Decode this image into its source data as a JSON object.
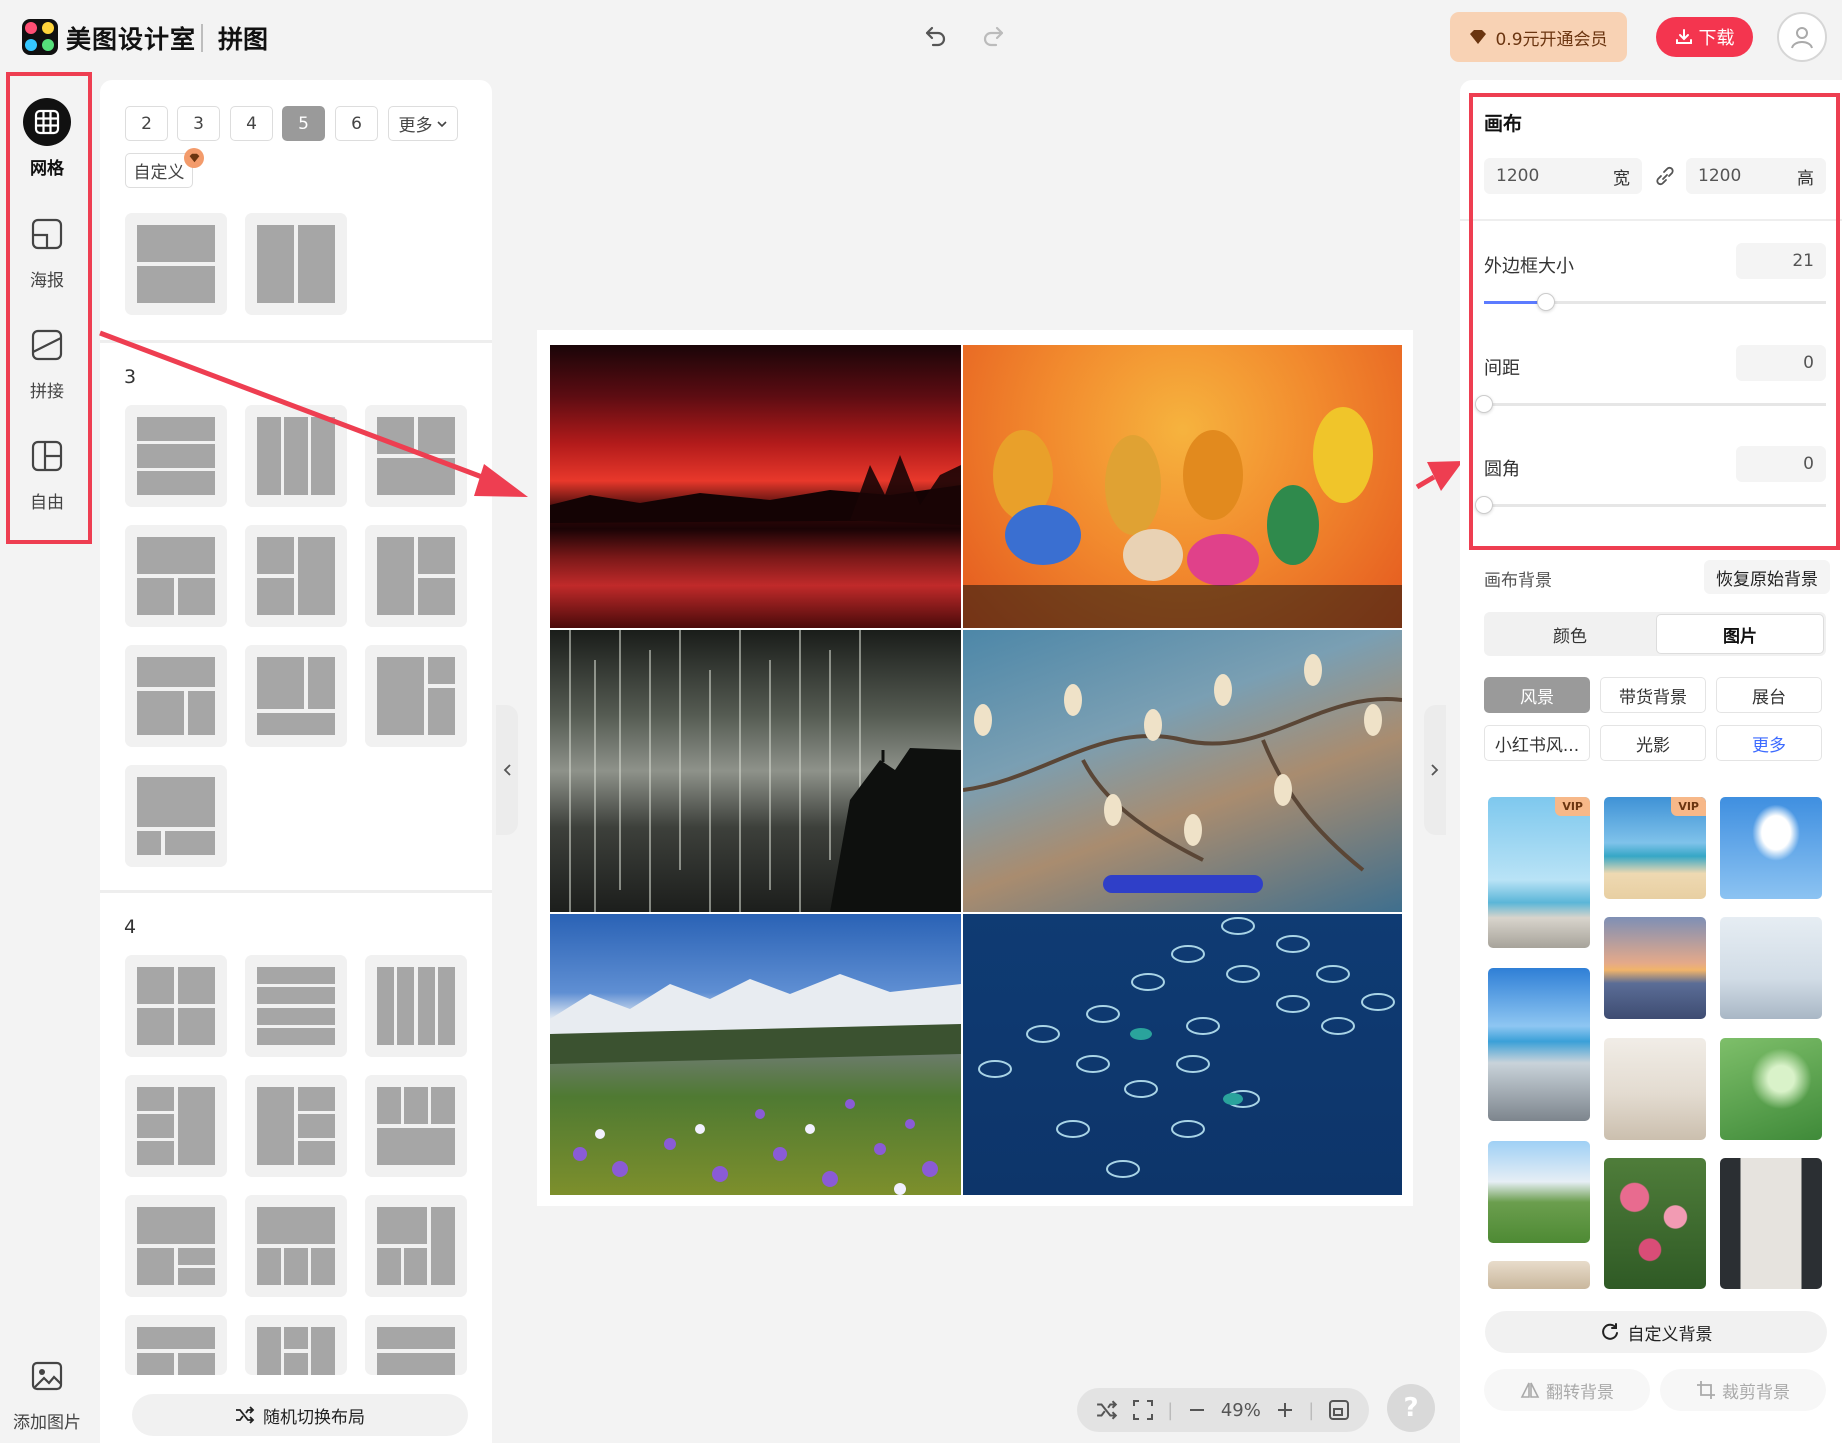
{
  "header": {
    "brand": "美图设计室",
    "page_title": "拼图",
    "vip_label": "0.9元开通会员",
    "download_label": "下载"
  },
  "rail": {
    "items": [
      {
        "label": "网格",
        "icon": "grid-icon"
      },
      {
        "label": "海报",
        "icon": "poster-icon"
      },
      {
        "label": "拼接",
        "icon": "splice-icon"
      },
      {
        "label": "自由",
        "icon": "freeform-icon"
      }
    ],
    "add_image_label": "添加图片"
  },
  "layouts": {
    "counts": [
      "2",
      "3",
      "4",
      "5",
      "6"
    ],
    "selected_count": "5",
    "more_label": "更多",
    "custom_label": "自定义",
    "sections": [
      "3",
      "4"
    ],
    "shuffle_label": "随机切换布局"
  },
  "canvas": {
    "photos": [
      "sunset-lake-photo",
      "painted-hands-photo",
      "waterfall-photo",
      "magnolia-branches-photo",
      "alpine-crocus-meadow-photo",
      "ocean-fish-farms-photo"
    ]
  },
  "zoom": {
    "level": "49%"
  },
  "settings": {
    "canvas_title": "画布",
    "width_value": "1200",
    "width_unit": "宽",
    "height_value": "1200",
    "height_unit": "高",
    "border_label": "外边框大小",
    "border_value": "21",
    "border_fraction": 0.18,
    "spacing_label": "间距",
    "spacing_value": "0",
    "spacing_fraction": 0,
    "radius_label": "圆角",
    "radius_value": "0",
    "radius_fraction": 0
  },
  "background": {
    "title": "画布背景",
    "restore_label": "恢复原始背景",
    "tabs": [
      "颜色",
      "图片"
    ],
    "active_tab": "图片",
    "categories": [
      "风景",
      "带货背景",
      "展台",
      "小红书风...",
      "光影",
      "更多"
    ],
    "active_category": "风景",
    "vip_tag": "VIP",
    "custom_label": "自定义背景",
    "flip_label": "翻转背景",
    "crop_label": "裁剪背景"
  },
  "colors": {
    "accent_red": "#f4354f",
    "annotation_red": "#ee3e51",
    "slider_blue": "#5c7bff",
    "more_link_blue": "#3d6bff"
  }
}
